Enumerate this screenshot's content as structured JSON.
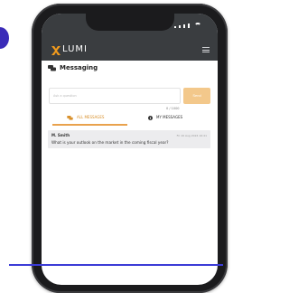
{
  "app": {
    "brand_name": "LUMI",
    "brand_color": "#f29b1c",
    "header_bg": "#3a3d40"
  },
  "messaging": {
    "title": "Messaging",
    "question_placeholder": "Ask a question",
    "send_label": "Send",
    "char_count": "0 / 1000"
  },
  "tabs": [
    {
      "label": "ALL MESSAGES",
      "icon": "chat-icon",
      "active": true
    },
    {
      "label": "MY MESSAGES",
      "icon": "info-icon",
      "active": false
    }
  ],
  "messages": [
    {
      "sender": "M. Smith",
      "timestamp": "Fri 16 Aug 2024 16:41",
      "text": "What is your outlook on the market in the coming fiscal year?"
    }
  ]
}
